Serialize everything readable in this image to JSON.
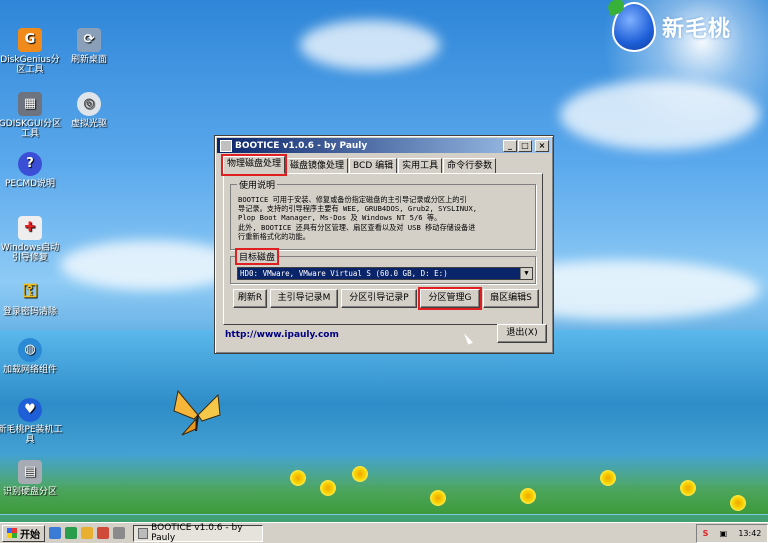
{
  "desktop": {
    "icons": [
      {
        "label": "DiskGenius分区工具"
      },
      {
        "label": "刷新桌面"
      },
      {
        "label": "GDISKGUI分区工具"
      },
      {
        "label": "虚拟光驱"
      },
      {
        "label": "PECMD说明"
      },
      {
        "label": "Windows启动引导修复"
      },
      {
        "label": "登录密码清除"
      },
      {
        "label": "加载网络组件"
      },
      {
        "label": "新毛桃PE装机工具"
      },
      {
        "label": "识别硬盘分区"
      }
    ],
    "logo_text": "新毛桃"
  },
  "window": {
    "title": "BOOTICE v1.0.6 - by Pauly",
    "controls": {
      "minimize": "_",
      "maximize": "□",
      "close": "×"
    },
    "tabs": [
      "物理磁盘处理",
      "磁盘镜像处理",
      "BCD 编辑",
      "实用工具",
      "命令行参数"
    ],
    "usage": {
      "label": "使用说明",
      "lines": [
        "BOOTICE 可用于安装、修复或备份指定磁盘的主引导记录或分区上的引",
        "导记录。支持的引导程序主要有 WEE, GRUB4DOS, Grub2, SYSLINUX,",
        "Plop Boot Manager, Ms-Dos 及 Windows NT 5/6 等。",
        "此外, BOOTICE 还具有分区管理、扇区查看以及对 USB 移动存储设备进",
        "行重新格式化的功能。"
      ]
    },
    "target_disk": {
      "label": "目标磁盘",
      "selected": "HD0: VMware, VMware Virtual S (60.0 GB, D: E:)"
    },
    "buttons": {
      "refresh": "刷新R",
      "mbr": "主引导记录M",
      "pbr": "分区引导记录P",
      "parts": "分区管理G",
      "sector": "扇区编辑S",
      "exit": "退出(X)"
    },
    "url": "http://www.ipauly.com"
  },
  "taskbar": {
    "start_label": "开始",
    "task_label": "BOOTICE v1.0.6 - by Pauly",
    "tray_time": "13:42"
  }
}
